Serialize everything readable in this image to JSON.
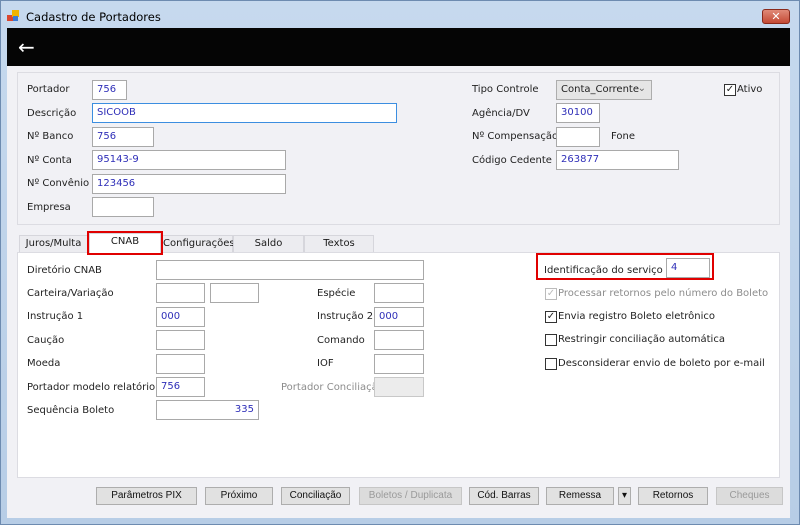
{
  "window": {
    "title": "Cadastro de Portadores",
    "close_label": "✕"
  },
  "header": {
    "back_icon": "←"
  },
  "main": {
    "portador": {
      "label": "Portador",
      "value": "756"
    },
    "descricao": {
      "label": "Descrição",
      "value": "SICOOB"
    },
    "banco": {
      "label": "Nº Banco",
      "value": "756"
    },
    "conta": {
      "label": "Nº Conta",
      "value": "95143-9"
    },
    "convenio": {
      "label": "Nº Convênio",
      "value": "123456"
    },
    "empresa": {
      "label": "Empresa",
      "value": ""
    },
    "tipo_controle": {
      "label": "Tipo Controle",
      "value": "Conta_Corrente"
    },
    "agencia": {
      "label": "Agência/DV",
      "value": "30100"
    },
    "compensacao": {
      "label": "Nº Compensação",
      "value": ""
    },
    "fone": {
      "label": "Fone"
    },
    "cedente": {
      "label": "Código Cedente",
      "value": "263877"
    },
    "ativo": {
      "label": "Ativo",
      "checked": true
    }
  },
  "tabs": [
    {
      "label": "Juros/Multa"
    },
    {
      "label": "CNAB",
      "active": true
    },
    {
      "label": "Configurações"
    },
    {
      "label": "Saldo"
    },
    {
      "label": "Textos"
    }
  ],
  "cnab": {
    "diretorio": {
      "label": "Diretório CNAB",
      "value": ""
    },
    "carteira": {
      "label": "Carteira/Variação",
      "value1": "",
      "value2": ""
    },
    "especie": {
      "label": "Espécie",
      "value": ""
    },
    "instrucao1": {
      "label": "Instrução 1",
      "value": "000"
    },
    "instrucao2": {
      "label": "Instrução 2",
      "value": "000"
    },
    "caucao": {
      "label": "Caução",
      "value": ""
    },
    "comando": {
      "label": "Comando",
      "value": ""
    },
    "moeda": {
      "label": "Moeda",
      "value": ""
    },
    "iof": {
      "label": "IOF",
      "value": ""
    },
    "portador_modelo": {
      "label": "Portador modelo relatório",
      "value": "756"
    },
    "portador_conciliacao": {
      "label": "Portador Conciliação",
      "value": ""
    },
    "sequencia": {
      "label": "Sequência Boleto",
      "value": "335"
    },
    "ident_servico": {
      "label": "Identificação do serviço",
      "value": "4"
    },
    "checks": [
      {
        "label": "Processar retornos pelo número do Boleto",
        "checked": true,
        "disabled": true
      },
      {
        "label": "Envia registro Boleto eletrônico",
        "checked": true
      },
      {
        "label": "Restringir conciliação automática",
        "checked": false
      },
      {
        "label": "Desconsiderar envio de boleto por e-mail",
        "checked": false
      }
    ]
  },
  "buttons": {
    "pix": "Parâmetros PIX",
    "proximo": "Próximo",
    "conciliacao": "Conciliação",
    "boletos": "Boletos / Duplicata",
    "barras": "Cód. Barras",
    "remessa": "Remessa",
    "remessa_dropdown": "▾",
    "retornos": "Retornos",
    "cheques": "Cheques"
  }
}
